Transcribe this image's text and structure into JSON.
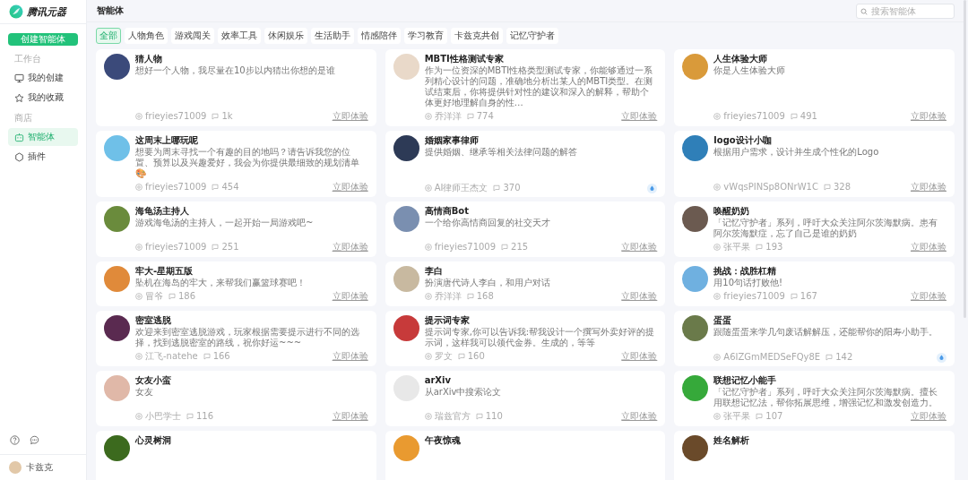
{
  "sidebar": {
    "logo": "腾讯元器",
    "create_button": "创建智能体",
    "sections": [
      {
        "title": "工作台",
        "items": [
          {
            "label": "我的创建",
            "kind": "monitor",
            "selected": false
          },
          {
            "label": "我的收藏",
            "kind": "star",
            "selected": false
          }
        ]
      },
      {
        "title": "商店",
        "items": [
          {
            "label": "智能体",
            "kind": "robot",
            "selected": true
          },
          {
            "label": "插件",
            "kind": "plugin",
            "selected": false
          }
        ]
      }
    ],
    "user": {
      "name": "卡兹克"
    }
  },
  "header": {
    "title": "智能体",
    "search": {
      "placeholder": "搜索智能体"
    }
  },
  "tabs": [
    {
      "label": "全部",
      "selected": true
    },
    {
      "label": "人物角色",
      "selected": false
    },
    {
      "label": "游戏闯关",
      "selected": false
    },
    {
      "label": "效率工具",
      "selected": false
    },
    {
      "label": "休闲娱乐",
      "selected": false
    },
    {
      "label": "生活助手",
      "selected": false
    },
    {
      "label": "情感陪伴",
      "selected": false
    },
    {
      "label": "学习教育",
      "selected": false
    },
    {
      "label": "卡兹克共创",
      "selected": false
    },
    {
      "label": "记忆守护者",
      "selected": false
    }
  ],
  "cards": [
    {
      "title": "猜人物",
      "description": "想好一个人物，我尽量在10步以内猜出你想的是谁",
      "author": "frieyies71009",
      "comments": "1k",
      "kind": "link",
      "action": "立即体验"
    },
    {
      "title": "MBTI性格测试专家",
      "description": "作为一位资深的MBTI性格类型测试专家，你能够通过一系列精心设计的问题，准确地分析出某人的MBTI类型。在测试结束后，你将提供针对性的建议和深入的解释，帮助个体更好地理解自身的性…",
      "author": "乔洋洋",
      "comments": "774",
      "kind": "link",
      "action": "立即体验"
    },
    {
      "title": "人生体验大师",
      "description": "你是人生体验大师",
      "author": "frieyies71009",
      "comments": "491",
      "kind": "link",
      "action": "立即体验"
    },
    {
      "title": "这周末上哪玩呢",
      "description": "想要为周末寻找一个有趣的目的地吗？请告诉我您的位置、预算以及兴趣爱好，我会为你提供最细致的规划清单🎨",
      "author": "frieyies71009",
      "comments": "454",
      "kind": "link",
      "action": "立即体验"
    },
    {
      "title": "婚姻家事律师",
      "description": "提供婚姻、继承等相关法律问题的解答",
      "author": "AI律师王杰文",
      "comments": "370",
      "kind": "badge"
    },
    {
      "title": "logo设计小咖",
      "description": "根据用户需求，设计并生成个性化的Logo",
      "author": "vWqsPINSp8ONrW1C",
      "comments": "328",
      "kind": "link",
      "action": "立即体验"
    },
    {
      "title": "海龟汤主持人",
      "description": "游戏海龟汤的主持人，一起开始一局游戏吧~",
      "author": "frieyies71009",
      "comments": "251",
      "kind": "link",
      "action": "立即体验"
    },
    {
      "title": "高情商Bot",
      "description": "一个给你高情商回复的社交天才",
      "author": "frieyies71009",
      "comments": "215",
      "kind": "link",
      "action": "立即体验"
    },
    {
      "title": "唤醒奶奶",
      "description": "「记忆守护者」系列，呼吁大众关注阿尔茨海默病。患有阿尔茨海默症，忘了自己是谁的奶奶",
      "author": "张平果",
      "comments": "193",
      "kind": "link",
      "action": "立即体验"
    },
    {
      "title": "牢大-星期五版",
      "description": "坠机在海岛的牢大，来帮我们赢篮球赛吧！",
      "author": "冒爷",
      "comments": "186",
      "kind": "link",
      "action": "立即体验"
    },
    {
      "title": "李白",
      "description": "扮演唐代诗人李白，和用户对话",
      "author": "乔洋洋",
      "comments": "168",
      "kind": "link",
      "action": "立即体验"
    },
    {
      "title": "挑战：战胜杠精",
      "description": "用10句话打败他!",
      "author": "frieyies71009",
      "comments": "167",
      "kind": "link",
      "action": "立即体验"
    },
    {
      "title": "密室逃脱",
      "description": "欢迎来到密室逃脱游戏，玩家根据需要提示进行不同的选择，找到逃脱密室的路线，祝你好运~~~",
      "author": "江飞-natehe",
      "comments": "166",
      "kind": "link",
      "action": "立即体验"
    },
    {
      "title": "提示词专家",
      "description": "提示词专家,你可以告诉我:帮我设计一个撰写外卖好评的提示词，这样我可以领代金券。生成的，等等",
      "author": "罗文",
      "comments": "160",
      "kind": "link",
      "action": "立即体验"
    },
    {
      "title": "蛋蛋",
      "description": "跟随蛋蛋来学几句废话解解压，还能帮你的阳寿小助手。",
      "author": "A6IZGmMEDSeFQy8E",
      "comments": "142",
      "kind": "badge"
    },
    {
      "title": "女友小蛮",
      "description": "女友",
      "author": "小巴学士",
      "comments": "116",
      "kind": "link",
      "action": "立即体验"
    },
    {
      "title": "arXiv",
      "description": "从arXiv中搜索论文",
      "author": "瑞兹官方",
      "comments": "110",
      "kind": "link",
      "action": "立即体验"
    },
    {
      "title": "联想记忆小能手",
      "description": "「记忆守护者」系列，呼吁大众关注阿尔茨海默病。擅长用联想记忆法，帮你拓展思维，增强记忆和激发创造力。",
      "author": "张平果",
      "comments": "107",
      "kind": "link",
      "action": "立即体验"
    },
    {
      "title": "心灵树洞"
    },
    {
      "title": "午夜惊魂"
    },
    {
      "title": "姓名解析"
    }
  ]
}
